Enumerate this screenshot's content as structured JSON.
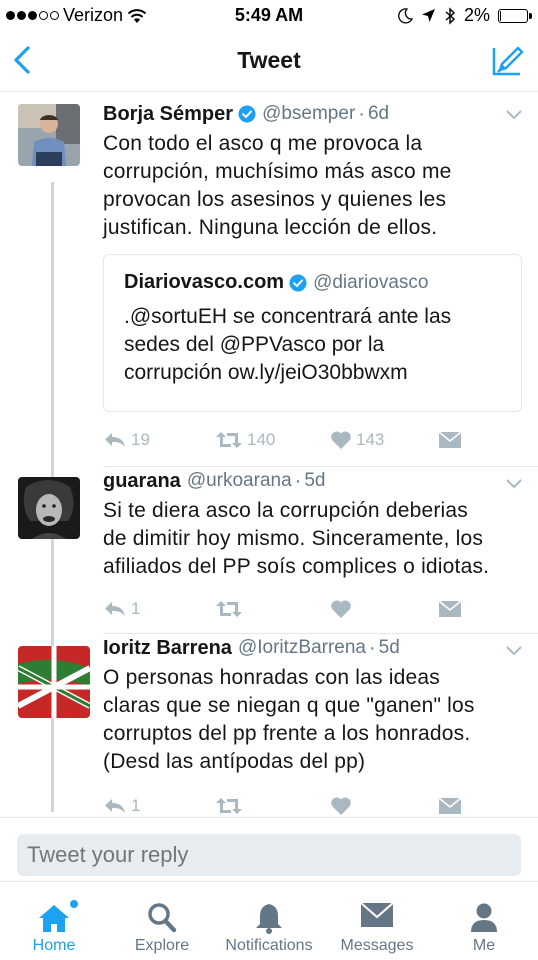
{
  "status_bar": {
    "carrier": "Verizon",
    "time": "5:49 AM",
    "battery": "2%",
    "battery_level": 0.02,
    "signal_bars_filled": 3,
    "signal_bars_total": 5
  },
  "nav": {
    "title": "Tweet"
  },
  "tweets": [
    {
      "name": "Borja Sémper",
      "verified": true,
      "handle": "@bsemper",
      "time": "6d",
      "text": "Con todo el asco q me provoca la\ncorrupción, muchísimo más asco me\nprovocan los asesinos y quienes les\njustifican. Ninguna lección de ellos.",
      "quote": {
        "name": "Diariovasco.com",
        "verified": true,
        "handle": "@diariovasco",
        "text": ".@sortuEH se concentrará ante las\nsedes del @PPVasco por la\ncorrupción ow.ly/jeiO30bbwxm"
      },
      "replies": "19",
      "retweets": "140",
      "likes": "143"
    },
    {
      "name": "guarana",
      "verified": false,
      "handle": "@urkoarana",
      "time": "5d",
      "text": "Si te diera asco la corrupción deberias\nde dimitir hoy mismo. Sinceramente, los\nafiliados del PP soís complices o idiotas.",
      "replies": "1",
      "retweets": "",
      "likes": ""
    },
    {
      "name": "Ioritz Barrena",
      "verified": false,
      "handle": "@IoritzBarrena",
      "time": "5d",
      "text": "O personas honradas con las ideas\nclaras que se niegan q que \"ganen\" los\ncorruptos del pp frente a los honrados.\n(Desd las antípodas del pp)",
      "replies": "1",
      "retweets": "",
      "likes": ""
    }
  ],
  "reply": {
    "placeholder": "Tweet your reply"
  },
  "tabs": [
    {
      "label": "Home",
      "icon": "home-icon",
      "active": true
    },
    {
      "label": "Explore",
      "icon": "search-icon",
      "active": false
    },
    {
      "label": "Notifications",
      "icon": "bell-icon",
      "active": false
    },
    {
      "label": "Messages",
      "icon": "envelope-icon",
      "active": false
    },
    {
      "label": "Me",
      "icon": "person-icon",
      "active": false
    }
  ],
  "colors": {
    "accent": "#1da1f2",
    "secondary_text": "#657786",
    "icon_gray": "#aab8c2"
  }
}
